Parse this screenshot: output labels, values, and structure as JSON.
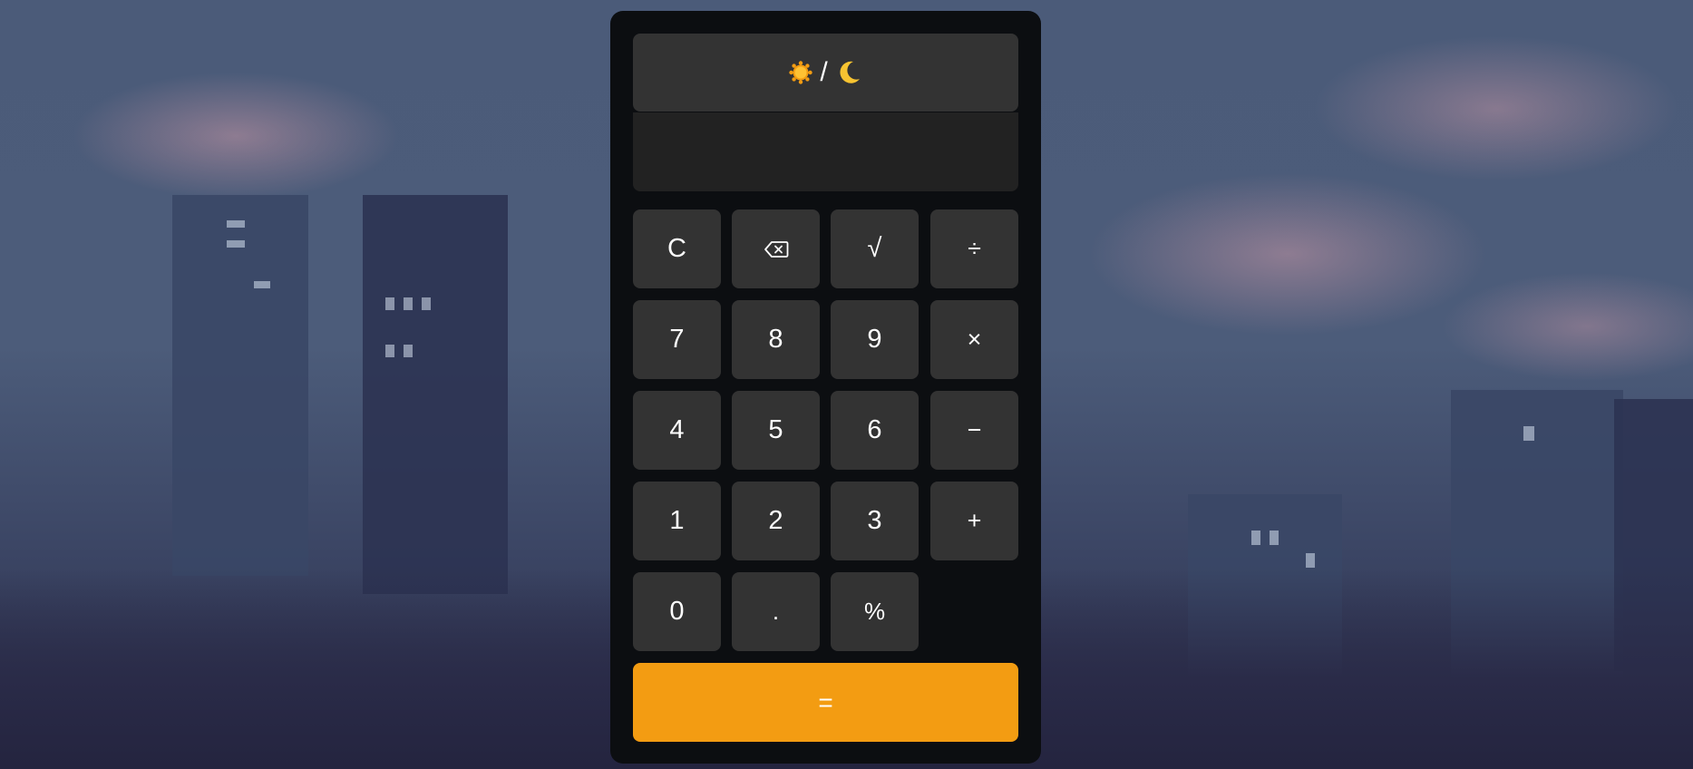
{
  "theme_toggle": {
    "sun_icon": "sun-icon",
    "separator": "/",
    "moon_icon": "moon-icon"
  },
  "display": {
    "value": ""
  },
  "keys": {
    "clear": "C",
    "backspace_icon": "backspace-icon",
    "sqrt": "√",
    "divide": "÷",
    "seven": "7",
    "eight": "8",
    "nine": "9",
    "multiply": "×",
    "four": "4",
    "five": "5",
    "six": "6",
    "minus": "−",
    "one": "1",
    "two": "2",
    "three": "3",
    "plus": "+",
    "zero": "0",
    "decimal": ".",
    "percent": "%",
    "equals": "="
  },
  "colors": {
    "accent": "#f39c12",
    "key_bg": "#333333",
    "display_bg": "#222222",
    "panel_bg": "#0c0e11"
  }
}
